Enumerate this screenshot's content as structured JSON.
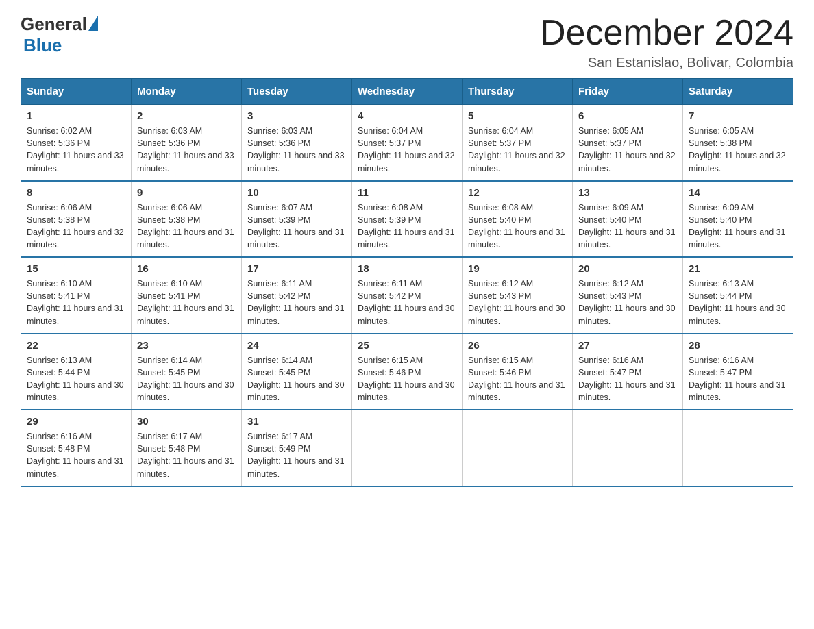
{
  "logo": {
    "general": "General",
    "triangle_color": "#1a6fad",
    "blue": "Blue"
  },
  "title": "December 2024",
  "subtitle": "San Estanislao, Bolivar, Colombia",
  "days_of_week": [
    "Sunday",
    "Monday",
    "Tuesday",
    "Wednesday",
    "Thursday",
    "Friday",
    "Saturday"
  ],
  "weeks": [
    [
      {
        "day": "1",
        "sunrise": "6:02 AM",
        "sunset": "5:36 PM",
        "daylight": "11 hours and 33 minutes."
      },
      {
        "day": "2",
        "sunrise": "6:03 AM",
        "sunset": "5:36 PM",
        "daylight": "11 hours and 33 minutes."
      },
      {
        "day": "3",
        "sunrise": "6:03 AM",
        "sunset": "5:36 PM",
        "daylight": "11 hours and 33 minutes."
      },
      {
        "day": "4",
        "sunrise": "6:04 AM",
        "sunset": "5:37 PM",
        "daylight": "11 hours and 32 minutes."
      },
      {
        "day": "5",
        "sunrise": "6:04 AM",
        "sunset": "5:37 PM",
        "daylight": "11 hours and 32 minutes."
      },
      {
        "day": "6",
        "sunrise": "6:05 AM",
        "sunset": "5:37 PM",
        "daylight": "11 hours and 32 minutes."
      },
      {
        "day": "7",
        "sunrise": "6:05 AM",
        "sunset": "5:38 PM",
        "daylight": "11 hours and 32 minutes."
      }
    ],
    [
      {
        "day": "8",
        "sunrise": "6:06 AM",
        "sunset": "5:38 PM",
        "daylight": "11 hours and 32 minutes."
      },
      {
        "day": "9",
        "sunrise": "6:06 AM",
        "sunset": "5:38 PM",
        "daylight": "11 hours and 31 minutes."
      },
      {
        "day": "10",
        "sunrise": "6:07 AM",
        "sunset": "5:39 PM",
        "daylight": "11 hours and 31 minutes."
      },
      {
        "day": "11",
        "sunrise": "6:08 AM",
        "sunset": "5:39 PM",
        "daylight": "11 hours and 31 minutes."
      },
      {
        "day": "12",
        "sunrise": "6:08 AM",
        "sunset": "5:40 PM",
        "daylight": "11 hours and 31 minutes."
      },
      {
        "day": "13",
        "sunrise": "6:09 AM",
        "sunset": "5:40 PM",
        "daylight": "11 hours and 31 minutes."
      },
      {
        "day": "14",
        "sunrise": "6:09 AM",
        "sunset": "5:40 PM",
        "daylight": "11 hours and 31 minutes."
      }
    ],
    [
      {
        "day": "15",
        "sunrise": "6:10 AM",
        "sunset": "5:41 PM",
        "daylight": "11 hours and 31 minutes."
      },
      {
        "day": "16",
        "sunrise": "6:10 AM",
        "sunset": "5:41 PM",
        "daylight": "11 hours and 31 minutes."
      },
      {
        "day": "17",
        "sunrise": "6:11 AM",
        "sunset": "5:42 PM",
        "daylight": "11 hours and 31 minutes."
      },
      {
        "day": "18",
        "sunrise": "6:11 AM",
        "sunset": "5:42 PM",
        "daylight": "11 hours and 30 minutes."
      },
      {
        "day": "19",
        "sunrise": "6:12 AM",
        "sunset": "5:43 PM",
        "daylight": "11 hours and 30 minutes."
      },
      {
        "day": "20",
        "sunrise": "6:12 AM",
        "sunset": "5:43 PM",
        "daylight": "11 hours and 30 minutes."
      },
      {
        "day": "21",
        "sunrise": "6:13 AM",
        "sunset": "5:44 PM",
        "daylight": "11 hours and 30 minutes."
      }
    ],
    [
      {
        "day": "22",
        "sunrise": "6:13 AM",
        "sunset": "5:44 PM",
        "daylight": "11 hours and 30 minutes."
      },
      {
        "day": "23",
        "sunrise": "6:14 AM",
        "sunset": "5:45 PM",
        "daylight": "11 hours and 30 minutes."
      },
      {
        "day": "24",
        "sunrise": "6:14 AM",
        "sunset": "5:45 PM",
        "daylight": "11 hours and 30 minutes."
      },
      {
        "day": "25",
        "sunrise": "6:15 AM",
        "sunset": "5:46 PM",
        "daylight": "11 hours and 30 minutes."
      },
      {
        "day": "26",
        "sunrise": "6:15 AM",
        "sunset": "5:46 PM",
        "daylight": "11 hours and 31 minutes."
      },
      {
        "day": "27",
        "sunrise": "6:16 AM",
        "sunset": "5:47 PM",
        "daylight": "11 hours and 31 minutes."
      },
      {
        "day": "28",
        "sunrise": "6:16 AM",
        "sunset": "5:47 PM",
        "daylight": "11 hours and 31 minutes."
      }
    ],
    [
      {
        "day": "29",
        "sunrise": "6:16 AM",
        "sunset": "5:48 PM",
        "daylight": "11 hours and 31 minutes."
      },
      {
        "day": "30",
        "sunrise": "6:17 AM",
        "sunset": "5:48 PM",
        "daylight": "11 hours and 31 minutes."
      },
      {
        "day": "31",
        "sunrise": "6:17 AM",
        "sunset": "5:49 PM",
        "daylight": "11 hours and 31 minutes."
      },
      null,
      null,
      null,
      null
    ]
  ],
  "labels": {
    "sunrise": "Sunrise: ",
    "sunset": "Sunset: ",
    "daylight": "Daylight: "
  }
}
